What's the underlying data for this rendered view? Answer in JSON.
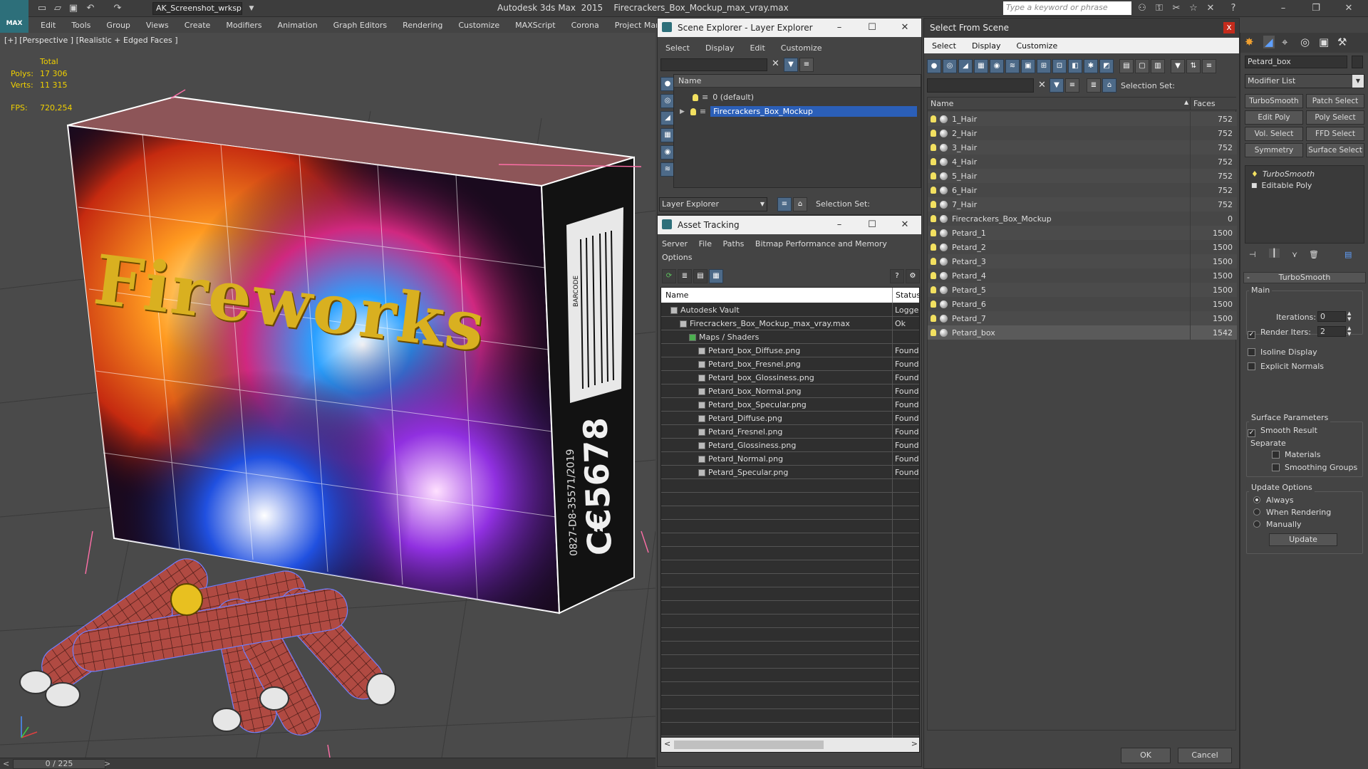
{
  "titlebar": {
    "workspace": "AK_Screenshot_wrksp",
    "app_title": "Autodesk 3ds Max  2015    Firecrackers_Box_Mockup_max_vray.max",
    "search_placeholder": "Type a keyword or phrase",
    "logo": "MAX"
  },
  "menu": [
    "Edit",
    "Tools",
    "Group",
    "Views",
    "Create",
    "Modifiers",
    "Animation",
    "Graph Editors",
    "Rendering",
    "Customize",
    "MAXScript",
    "Corona",
    "Project Man"
  ],
  "viewport": {
    "label": "[+] [Perspective ] [Realistic + Edged Faces ]",
    "stats": {
      "total_label": "Total",
      "polys_label": "Polys:",
      "polys": "17 306",
      "verts_label": "Verts:",
      "verts": "11 315",
      "fps_label": "FPS:",
      "fps": "720,254"
    },
    "box_title": "Fireworks",
    "barcode": "BARCODE",
    "ce_mark": "C€5678",
    "cert": "0827-D8-35571/2019"
  },
  "timeline": {
    "frame": "0 / 225"
  },
  "scene_explorer": {
    "title": "Scene Explorer - Layer Explorer",
    "menu": [
      "Select",
      "Display",
      "Edit",
      "Customize"
    ],
    "col_name": "Name",
    "rows": [
      {
        "label": "0 (default)",
        "selected": false
      },
      {
        "label": "Firecrackers_Box_Mockup",
        "selected": true
      }
    ],
    "footer_dropdown": "Layer Explorer",
    "selection_set_label": "Selection Set:"
  },
  "asset_tracking": {
    "title": "Asset Tracking",
    "menu": [
      "Server",
      "File",
      "Paths",
      "Bitmap Performance and Memory",
      "Options"
    ],
    "col_name": "Name",
    "col_status": "Status",
    "rows": [
      {
        "name": "Autodesk Vault",
        "status": "Logged",
        "indent": 1
      },
      {
        "name": "Firecrackers_Box_Mockup_max_vray.max",
        "status": "Ok",
        "indent": 2
      },
      {
        "name": "Maps / Shaders",
        "status": "",
        "indent": 3
      },
      {
        "name": "Petard_box_Diffuse.png",
        "status": "Found",
        "indent": 4
      },
      {
        "name": "Petard_box_Fresnel.png",
        "status": "Found",
        "indent": 4
      },
      {
        "name": "Petard_box_Glossiness.png",
        "status": "Found",
        "indent": 4
      },
      {
        "name": "Petard_box_Normal.png",
        "status": "Found",
        "indent": 4
      },
      {
        "name": "Petard_box_Specular.png",
        "status": "Found",
        "indent": 4
      },
      {
        "name": "Petard_Diffuse.png",
        "status": "Found",
        "indent": 4
      },
      {
        "name": "Petard_Fresnel.png",
        "status": "Found",
        "indent": 4
      },
      {
        "name": "Petard_Glossiness.png",
        "status": "Found",
        "indent": 4
      },
      {
        "name": "Petard_Normal.png",
        "status": "Found",
        "indent": 4
      },
      {
        "name": "Petard_Specular.png",
        "status": "Found",
        "indent": 4
      }
    ]
  },
  "select_from_scene": {
    "title": "Select From Scene",
    "close": "x",
    "menu": [
      "Select",
      "Display",
      "Customize"
    ],
    "selection_set_label": "Selection Set:",
    "col_name": "Name",
    "col_faces": "Faces",
    "rows": [
      {
        "name": "1_Hair",
        "faces": "752"
      },
      {
        "name": "2_Hair",
        "faces": "752"
      },
      {
        "name": "3_Hair",
        "faces": "752"
      },
      {
        "name": "4_Hair",
        "faces": "752"
      },
      {
        "name": "5_Hair",
        "faces": "752"
      },
      {
        "name": "6_Hair",
        "faces": "752"
      },
      {
        "name": "7_Hair",
        "faces": "752"
      },
      {
        "name": "Firecrackers_Box_Mockup",
        "faces": "0"
      },
      {
        "name": "Petard_1",
        "faces": "1500"
      },
      {
        "name": "Petard_2",
        "faces": "1500"
      },
      {
        "name": "Petard_3",
        "faces": "1500"
      },
      {
        "name": "Petard_4",
        "faces": "1500"
      },
      {
        "name": "Petard_5",
        "faces": "1500"
      },
      {
        "name": "Petard_6",
        "faces": "1500"
      },
      {
        "name": "Petard_7",
        "faces": "1500"
      },
      {
        "name": "Petard_box",
        "faces": "1542"
      }
    ],
    "ok": "OK",
    "cancel": "Cancel"
  },
  "command_panel": {
    "object_name": "Petard_box",
    "modifier_list": "Modifier List",
    "mod_buttons": [
      "TurboSmooth",
      "Patch Select",
      "Edit Poly",
      "Poly Select",
      "Vol. Select",
      "FFD Select",
      "Symmetry",
      "Surface Select"
    ],
    "stack": [
      "TurboSmooth",
      "Editable Poly"
    ],
    "rollout": "TurboSmooth",
    "main_label": "Main",
    "iterations_label": "Iterations:",
    "iterations": "0",
    "render_iters_label": "Render Iters:",
    "render_iters": "2",
    "isoline": "Isoline Display",
    "explicit_normals": "Explicit Normals",
    "surface_params": "Surface Parameters",
    "smooth_result": "Smooth Result",
    "separate": "Separate",
    "materials": "Materials",
    "smoothing_groups": "Smoothing Groups",
    "update_options": "Update Options",
    "always": "Always",
    "when_rendering": "When Rendering",
    "manually": "Manually",
    "update": "Update"
  },
  "colors": {
    "selection": "#2b5fb8",
    "stats": "#f0d000",
    "accent": "#4d6a88"
  }
}
